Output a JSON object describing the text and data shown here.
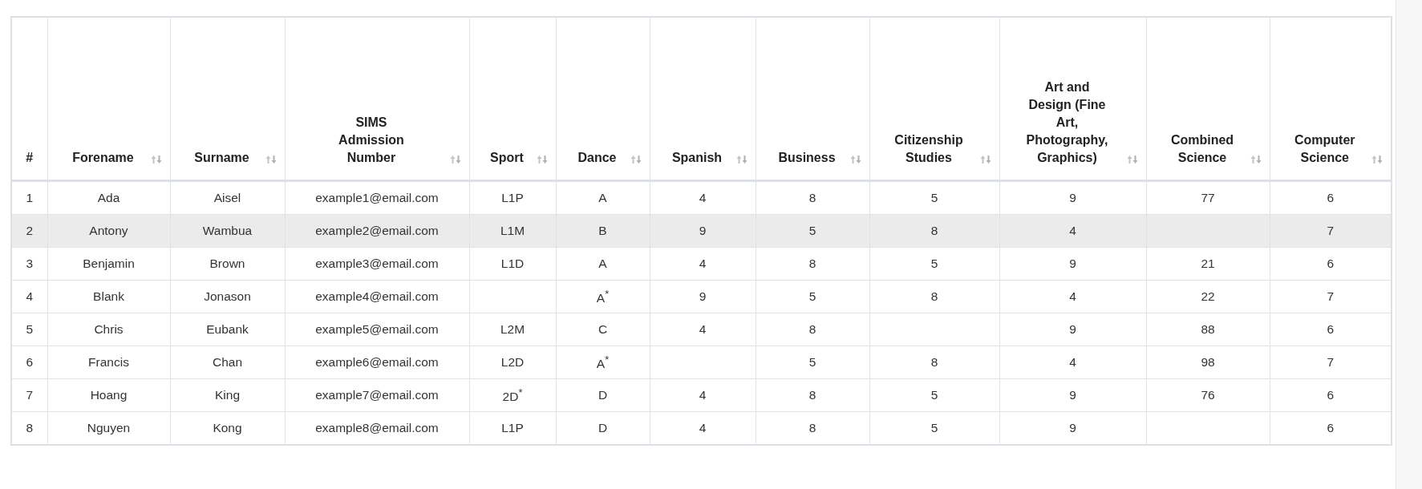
{
  "table": {
    "columns": [
      {
        "label": "#",
        "sortable": false
      },
      {
        "label": "Forename",
        "sortable": true
      },
      {
        "label": "Surname",
        "sortable": true
      },
      {
        "label": "SIMS Admission Number",
        "sortable": true
      },
      {
        "label": "Sport",
        "sortable": true
      },
      {
        "label": "Dance",
        "sortable": true
      },
      {
        "label": "Spanish",
        "sortable": true
      },
      {
        "label": "Business",
        "sortable": true
      },
      {
        "label": "Citizenship Studies",
        "sortable": true
      },
      {
        "label": "Art and Design (Fine Art, Photography, Graphics)",
        "sortable": true
      },
      {
        "label": "Combined Science",
        "sortable": true
      },
      {
        "label": "Computer Science",
        "sortable": true
      }
    ],
    "rows": [
      {
        "selected": false,
        "cells": [
          "1",
          "Ada",
          "Aisel",
          "example1@email.com",
          "L1P",
          "A",
          "4",
          "8",
          "5",
          "9",
          "77",
          "6"
        ]
      },
      {
        "selected": true,
        "cells": [
          "2",
          "Antony",
          "Wambua",
          "example2@email.com",
          "L1M",
          "B",
          "9",
          "5",
          "8",
          "4",
          "",
          "7"
        ]
      },
      {
        "selected": false,
        "cells": [
          "3",
          "Benjamin",
          "Brown",
          "example3@email.com",
          "L1D",
          "A",
          "4",
          "8",
          "5",
          "9",
          "21",
          "6"
        ]
      },
      {
        "selected": false,
        "cells": [
          "4",
          "Blank",
          "Jonason",
          "example4@email.com",
          "",
          "A$^{*}$",
          "9",
          "5",
          "8",
          "4",
          "22",
          "7"
        ]
      },
      {
        "selected": false,
        "cells": [
          "5",
          "Chris",
          "Eubank",
          "example5@email.com",
          "L2M",
          "C",
          "4",
          "8",
          "",
          "9",
          "88",
          "6"
        ]
      },
      {
        "selected": false,
        "cells": [
          "6",
          "Francis",
          "Chan",
          "example6@email.com",
          "L2D",
          "A$^{*}$",
          "",
          "5",
          "8",
          "4",
          "98",
          "7"
        ]
      },
      {
        "selected": false,
        "cells": [
          "7",
          "Hoang",
          "King",
          "example7@email.com",
          "2D$^{*}$",
          "D",
          "4",
          "8",
          "5",
          "9",
          "76",
          "6"
        ]
      },
      {
        "selected": false,
        "cells": [
          "8",
          "Nguyen",
          "Kong",
          "example8@email.com",
          "L1P",
          "D",
          "4",
          "8",
          "5",
          "9",
          "",
          "6"
        ]
      }
    ]
  }
}
